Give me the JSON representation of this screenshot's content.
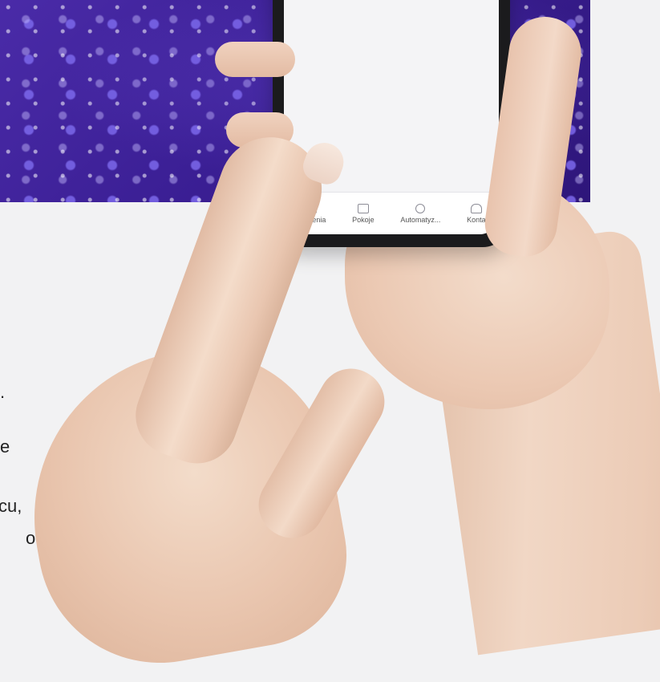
{
  "side_text": {
    "line1": ".",
    "line2": "e",
    "line3": "cu,",
    "line4": "o"
  },
  "phone_tabbar": {
    "tabs": [
      {
        "label": "ządzenia",
        "icon": "device-icon"
      },
      {
        "label": "Pokoje",
        "icon": "rooms-icon"
      },
      {
        "label": "Automatyz...",
        "icon": "automation-gears-icon"
      },
      {
        "label": "Konta",
        "icon": "home-icon"
      }
    ]
  },
  "colors": {
    "background": "#f2f2f3",
    "brand_purple": "#3b1f95"
  }
}
